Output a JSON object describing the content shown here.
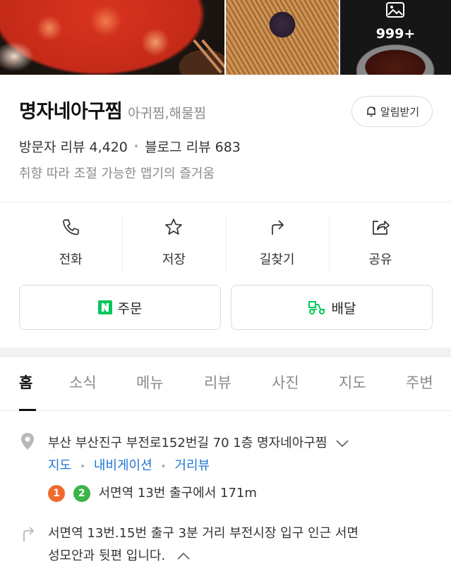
{
  "photos": {
    "more_count": "999+"
  },
  "place": {
    "name": "명자네아구찜",
    "category": "아귀찜,해물찜",
    "alarm_label": "알림받기",
    "visitor_reviews": "방문자 리뷰 4,420",
    "blog_reviews": "블로그 리뷰 683",
    "tagline": "취향 따라 조절 가능한 맵기의 즐거움"
  },
  "actions": [
    {
      "label": "전화",
      "icon": "phone-icon"
    },
    {
      "label": "저장",
      "icon": "star-icon"
    },
    {
      "label": "길찾기",
      "icon": "directions-icon"
    },
    {
      "label": "공유",
      "icon": "share-icon"
    }
  ],
  "order": {
    "order_label": "주문",
    "delivery_label": "배달",
    "naver_color": "#03c75a"
  },
  "tabs": [
    "홈",
    "소식",
    "메뉴",
    "리뷰",
    "사진",
    "지도",
    "주변"
  ],
  "info": {
    "address": "부산 부산진구 부전로152번길 70 1층 명자네아구찜",
    "links": [
      "지도",
      "내비게이션",
      "거리뷰"
    ],
    "subway_badges": [
      {
        "label": "1",
        "color": "#f06a2e"
      },
      {
        "label": "2",
        "color": "#3cb44a"
      }
    ],
    "station_text": "서면역 13번 출구에서 171m",
    "directions_line1": "서면역 13번.15번 출구 3분 거리 부전시장 입구 인근 서면",
    "directions_line2": "성모안과 뒷편 입니다."
  }
}
